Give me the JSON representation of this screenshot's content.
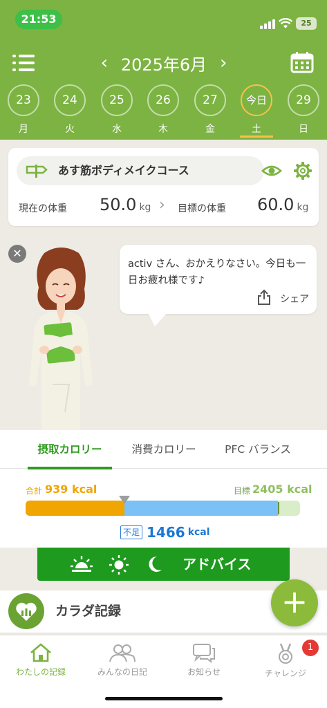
{
  "status_bar": {
    "time": "21:53",
    "battery": "25",
    "time_pill_color": "#3dbf48"
  },
  "header": {
    "menu_icon": "list-menu-icon",
    "prev_icon": "chevron-left-icon",
    "month_label": "2025年6月",
    "next_icon": "chevron-right-icon",
    "calendar_icon": "calendar-icon",
    "background_color": "#7cb342"
  },
  "days": [
    {
      "date": "23",
      "weekday": "月"
    },
    {
      "date": "24",
      "weekday": "火"
    },
    {
      "date": "25",
      "weekday": "水"
    },
    {
      "date": "26",
      "weekday": "木"
    },
    {
      "date": "27",
      "weekday": "金"
    },
    {
      "date": "今日",
      "weekday": "土",
      "selected": true
    },
    {
      "date": "29",
      "weekday": "日"
    }
  ],
  "course": {
    "name": "あす筋ボディメイクコース",
    "current_weight_label": "現在の体重",
    "current_weight": "50.0",
    "target_weight_label": "目標の体重",
    "target_weight": "60.0",
    "unit": "kg"
  },
  "message": {
    "text": "activ さん、おかえりなさい。今日も一日お疲れ様です♪",
    "share_label": "シェア"
  },
  "calorie_tabs": [
    "摂取カロリー",
    "消費カロリー",
    "PFC バランス"
  ],
  "calories": {
    "total_label": "合計",
    "total_value": "939 kcal",
    "goal_label": "目標",
    "goal_value": "2405 kcal",
    "shortage_tag": "不足",
    "shortage_value": "1466",
    "shortage_unit": "kcal",
    "intake": 939,
    "goal": 2405,
    "colors": {
      "intake": "#f0a500",
      "shortage": "#7cc1f5",
      "surplus": "#d9edc8",
      "active": "#2f9a1f"
    }
  },
  "advice": {
    "label": "アドバイス",
    "icons": [
      "sunrise-icon",
      "sun-icon",
      "moon-icon"
    ]
  },
  "record": {
    "label": "カラダ記録",
    "icon": "heart-chart-icon"
  },
  "tabbar": [
    {
      "label": "わたしの記録",
      "icon": "home-icon",
      "active": true
    },
    {
      "label": "みんなの日記",
      "icon": "people-icon"
    },
    {
      "label": "お知らせ",
      "icon": "chat-icon"
    },
    {
      "label": "チャレンジ",
      "icon": "medal-icon",
      "badge": "1"
    }
  ]
}
